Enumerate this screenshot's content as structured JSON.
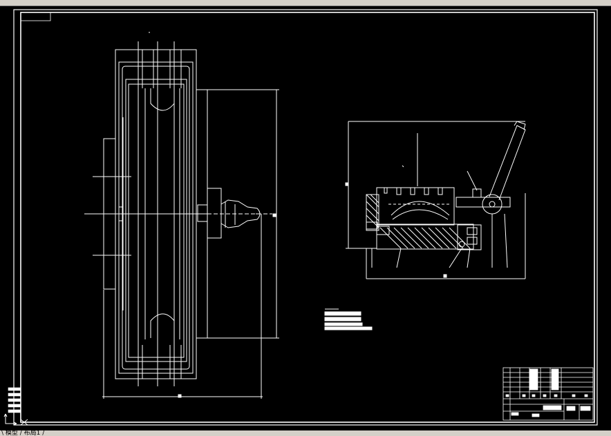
{
  "toolbar": {
    "buttons": [
      "new-icon",
      "open-icon",
      "save-icon",
      "print-icon",
      "preview-icon",
      "cut-icon",
      "copy-icon",
      "paste-icon",
      "match-icon",
      "undo-icon",
      "redo-icon",
      "pan-icon",
      "zoom-icon",
      "zoom-window-icon",
      "zoom-previous-icon",
      "properties-icon",
      "design-center-icon",
      "tool-palette-icon",
      "sheet-set-icon",
      "markup-icon",
      "calculator-icon",
      "help-icon"
    ]
  },
  "command_line": {
    "text": "\\ 模型 / 布局1 /"
  },
  "colors": {
    "background": "#000000",
    "lines": "#ffffff",
    "toolbar": "#d4d0c8"
  }
}
